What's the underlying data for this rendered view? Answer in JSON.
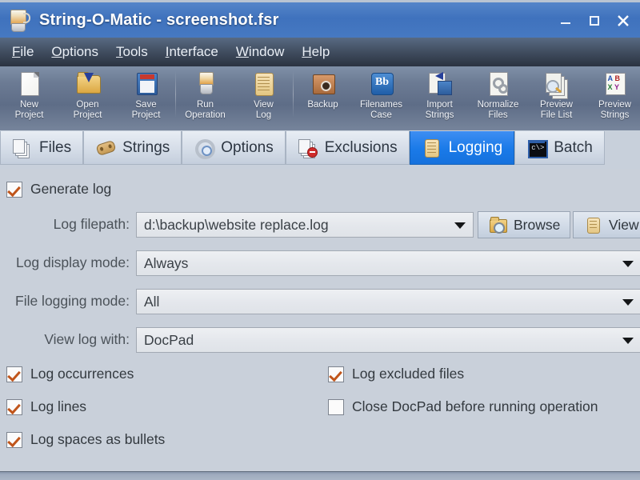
{
  "window": {
    "title": "String-O-Matic - screenshot.fsr",
    "app_icon": "blender-icon",
    "controls": {
      "minimize": "minimize-icon",
      "maximize": "maximize-icon",
      "close": "close-icon"
    }
  },
  "menubar": {
    "items": [
      {
        "label": "File",
        "mnemonic": "F",
        "rest": "ile"
      },
      {
        "label": "Options",
        "mnemonic": "O",
        "rest": "ptions"
      },
      {
        "label": "Tools",
        "mnemonic": "T",
        "rest": "ools"
      },
      {
        "label": "Interface",
        "mnemonic": "I",
        "rest": "nterface"
      },
      {
        "label": "Window",
        "mnemonic": "W",
        "rest": "indow"
      },
      {
        "label": "Help",
        "mnemonic": "H",
        "rest": "elp"
      }
    ]
  },
  "toolbar": {
    "items": [
      {
        "label": "New\nProject",
        "icon": "new-document-icon"
      },
      {
        "label": "Open\nProject",
        "icon": "open-folder-icon"
      },
      {
        "label": "Save\nProject",
        "icon": "floppy-disk-icon"
      },
      {
        "label": "Run\nOperation",
        "icon": "blender-icon"
      },
      {
        "label": "View\nLog",
        "icon": "scroll-icon"
      },
      {
        "label": "Backup",
        "icon": "safe-icon"
      },
      {
        "label": "Filenames\nCase",
        "icon": "bb-case-icon"
      },
      {
        "label": "Import\nStrings",
        "icon": "import-strings-icon"
      },
      {
        "label": "Normalize\nFiles",
        "icon": "gears-document-icon"
      },
      {
        "label": "Preview\nFile List",
        "icon": "preview-files-icon"
      },
      {
        "label": "Preview\nStrings",
        "icon": "preview-strings-icon"
      }
    ]
  },
  "tabs": [
    {
      "label": "Files",
      "icon": "files-icon",
      "active": false
    },
    {
      "label": "Strings",
      "icon": "strings-icon",
      "active": false
    },
    {
      "label": "Options",
      "icon": "options-gear-icon",
      "active": false
    },
    {
      "label": "Exclusions",
      "icon": "exclusions-icon",
      "active": false
    },
    {
      "label": "Logging",
      "icon": "scroll-icon",
      "active": true
    },
    {
      "label": "Batch",
      "icon": "console-icon",
      "active": false
    }
  ],
  "logging_panel": {
    "generate_log": {
      "label": "Generate log",
      "checked": true
    },
    "log_filepath": {
      "label": "Log filepath:",
      "value": "d:\\backup\\website replace.log",
      "browse_button": "Browse",
      "view_button": "View"
    },
    "log_display_mode": {
      "label": "Log display mode:",
      "value": "Always"
    },
    "file_logging_mode": {
      "label": "File logging mode:",
      "value": "All"
    },
    "view_log_with": {
      "label": "View log with:",
      "value": "DocPad"
    },
    "checkboxes_left": [
      {
        "label": "Log occurrences",
        "checked": true
      },
      {
        "label": "Log lines",
        "checked": true
      },
      {
        "label": "Log spaces as bullets",
        "checked": true
      }
    ],
    "checkboxes_right": [
      {
        "label": "Log excluded files",
        "checked": true
      },
      {
        "label": "Close DocPad before running operation",
        "checked": false
      }
    ]
  },
  "colors": {
    "title_bar": "#3f72bd",
    "menu_bar": "#3e4a5c",
    "toolbar": "#6c7b94",
    "panel_bg": "#c9d0da",
    "active_tab": "#1a7ae8",
    "checkbox_check": "#c0551b"
  }
}
